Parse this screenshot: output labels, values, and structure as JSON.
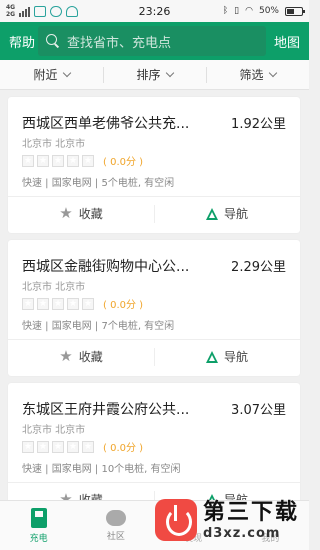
{
  "status_bar": {
    "network_top": "4G",
    "network_bottom": "2G",
    "time": "23:26",
    "battery": "50%"
  },
  "header": {
    "left_label": "帮助",
    "search_placeholder": "查找省市、充电点",
    "right_label": "地图",
    "color": "#0d9f69"
  },
  "filters": [
    {
      "label": "附近"
    },
    {
      "label": "排序"
    },
    {
      "label": "筛选"
    }
  ],
  "stations": [
    {
      "name": "西城区西单老佛爷公共充...",
      "distance": "1.92公里",
      "city": "北京市 北京市",
      "score": "( 0.0分 )",
      "info": "快速 | 国家电网 | 5个电桩, 有空闲",
      "favorite_label": "收藏",
      "navigate_label": "导航"
    },
    {
      "name": "西城区金融街购物中心公...",
      "distance": "2.29公里",
      "city": "北京市 北京市",
      "score": "( 0.0分 )",
      "info": "快速 | 国家电网 | 7个电桩, 有空闲",
      "favorite_label": "收藏",
      "navigate_label": "导航"
    },
    {
      "name": "东城区王府井霞公府公共...",
      "distance": "3.07公里",
      "city": "北京市 北京市",
      "score": "( 0.0分 )",
      "info": "快速 | 国家电网 | 10个电桩, 有空闲",
      "favorite_label": "收藏",
      "navigate_label": "导航"
    }
  ],
  "tabbar": [
    {
      "label": "充电",
      "icon": "charging-pump-icon",
      "active": true
    },
    {
      "label": "社区",
      "icon": "chat-bubble-icon",
      "active": false
    },
    {
      "label": "发现",
      "icon": "discover-icon",
      "active": false
    },
    {
      "label": "我的",
      "icon": "profile-icon",
      "active": false
    }
  ],
  "watermark": {
    "text": "第三下载",
    "url": "d3xz.com"
  }
}
